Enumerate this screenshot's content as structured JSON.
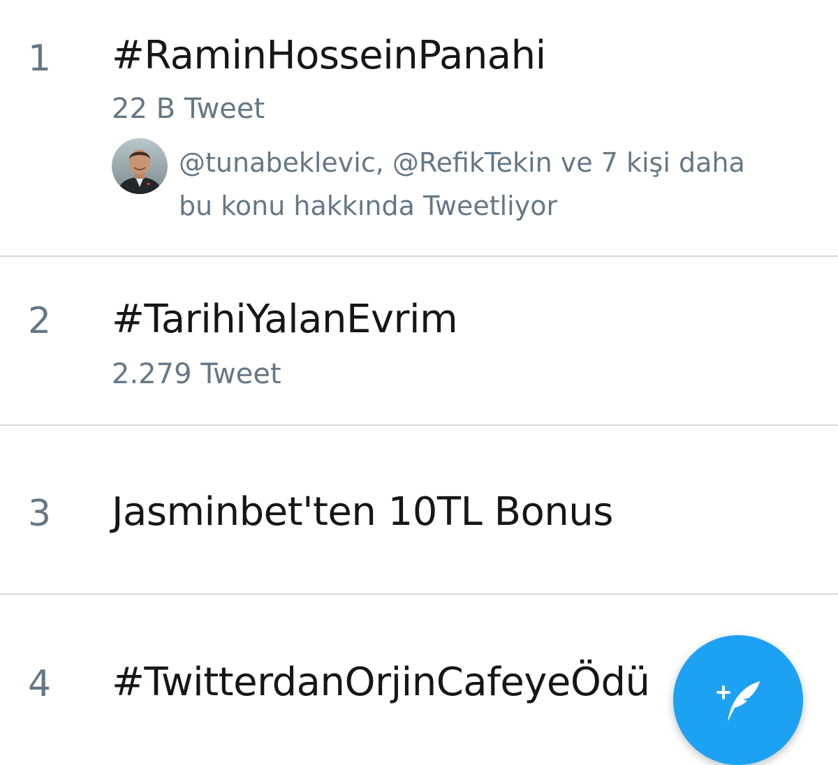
{
  "trends": [
    {
      "rank": "1",
      "title": "#RaminHosseinPanahi",
      "count": "22 B Tweet",
      "context_line1": "@tunabeklevic, @RefikTekin ve 7 kişi daha",
      "context_line2": "bu konu hakkında Tweetliyor"
    },
    {
      "rank": "2",
      "title": "#TarihiYalanEvrim",
      "count": "2.279 Tweet"
    },
    {
      "rank": "3",
      "title": "Jasminbet'ten 10TL Bonus"
    },
    {
      "rank": "4",
      "title": "#TwitterdanOrjinCafeyeÖdü"
    }
  ],
  "fab": {
    "icon": "compose-tweet-icon",
    "color": "#1da1f2"
  },
  "colors": {
    "primary_text": "#14171a",
    "secondary_text": "#657786",
    "divider": "#d6dbe0",
    "accent": "#1da1f2"
  }
}
